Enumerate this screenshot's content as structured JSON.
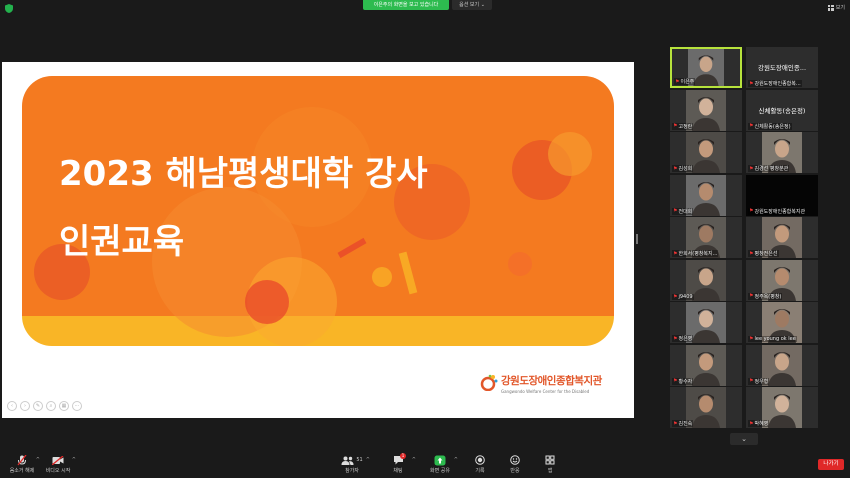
{
  "topbar": {
    "share_banner": "이은주의 화면을 보고 있습니다",
    "view_options": "옵션 보기",
    "view_button": "보기"
  },
  "slide": {
    "title": "2023 해남평생대학 강사",
    "subtitle": "인권교육",
    "logo_text": "강원도장애인종합복지관",
    "logo_english": "Gangwondo Welfare Center for the Disabled",
    "colors": {
      "orange": "#f47a20",
      "yellow": "#f9b526",
      "red": "#e8472a"
    }
  },
  "gallery": {
    "tiles": [
      {
        "name": "이은주",
        "type": "photo",
        "active": true
      },
      {
        "name": "강원도장애인종합복...",
        "type": "text",
        "big": "강원도장애인종..."
      },
      {
        "name": "고정란",
        "type": "photo"
      },
      {
        "name": "신체활동(송은정)",
        "type": "text",
        "big": "신체활동(송은정)"
      },
      {
        "name": "김성희",
        "type": "photo"
      },
      {
        "name": "김경선 평창분관",
        "type": "photo"
      },
      {
        "name": "전대희",
        "type": "photo"
      },
      {
        "name": "강원도장애인종합복지관",
        "type": "dark"
      },
      {
        "name": "한희서(평창복지...",
        "type": "photo"
      },
      {
        "name": "평창전은선",
        "type": "photo"
      },
      {
        "name": "j9409",
        "type": "photo"
      },
      {
        "name": "정주옥(평창)",
        "type": "photo"
      },
      {
        "name": "정은영",
        "type": "photo"
      },
      {
        "name": "lee young ok lee",
        "type": "photo"
      },
      {
        "name": "황수자",
        "type": "photo"
      },
      {
        "name": "정우형",
        "type": "photo"
      },
      {
        "name": "김진숙",
        "type": "photo"
      },
      {
        "name": "박혜영",
        "type": "photo"
      }
    ]
  },
  "toolbar": {
    "mute": "음소거 해제",
    "video": "비디오 시작",
    "participants": "참가자",
    "participants_count": "51",
    "chat": "채팅",
    "chat_badge": "1",
    "share": "화면 공유",
    "record": "기록",
    "reactions": "반응",
    "apps": "앱",
    "leave": "나가기"
  }
}
